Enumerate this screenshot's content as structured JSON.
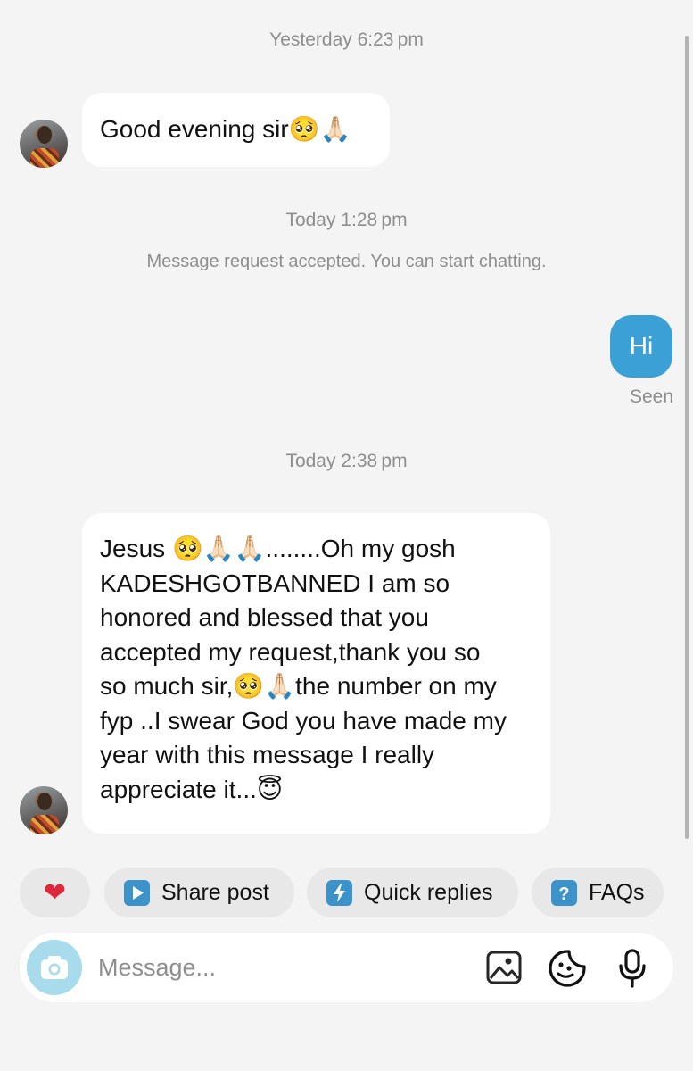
{
  "messages": {
    "ts1": "Yesterday 6:23 pm",
    "msg1": "Good evening sir",
    "msg1_emoji": "🥺🙏🏻",
    "ts2": "Today 1:28 pm",
    "system": "Message request accepted. You can start chatting.",
    "out1": "Hi",
    "seen": "Seen",
    "ts3": "Today 2:38 pm",
    "long": {
      "l1a": "Jesus ",
      "l1e": "🥺🙏🏻🙏🏻",
      "l1b": "........Oh my gosh",
      "l2": "KADESHGOTBANNED I am so",
      "l3": "honored and blessed that you",
      "l4": "accepted my request,thank you so",
      "l5a": "so much sir,",
      "l5e": "🥺🙏🏻",
      "l5b": "the number on my",
      "l6": "fyp ..I  swear God you have made my",
      "l7": "year with this message I really",
      "l8a": "appreciate it...",
      "l8e": "😇"
    }
  },
  "quick_actions": {
    "heart": "❤",
    "share_post": "Share post",
    "quick_replies": "Quick replies",
    "faqs": "FAQs"
  },
  "composer": {
    "placeholder": "Message..."
  },
  "colors": {
    "accent": "#3aa0d6",
    "background": "#f4f4f4",
    "heart": "#e0263a"
  }
}
